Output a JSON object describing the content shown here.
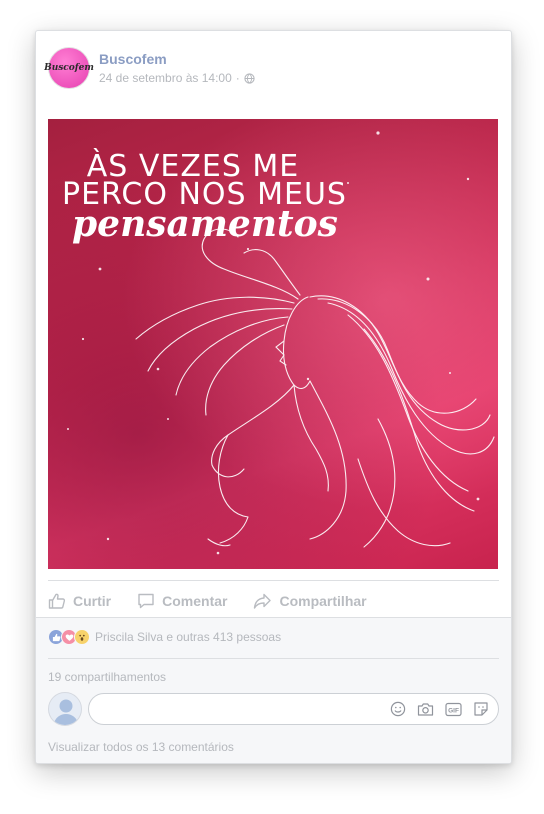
{
  "post": {
    "page_name": "Buscofem",
    "avatar_text": "Buscofem",
    "timestamp": "24 de setembro às 14:00",
    "separator": "·",
    "privacy_icon": "globe-icon"
  },
  "image": {
    "line1": "ÀS VEZES ME",
    "line2": "PERCO NOS MEUS",
    "line3": "pensamentos"
  },
  "actions": {
    "like": "Curtir",
    "comment": "Comentar",
    "share": "Compartilhar"
  },
  "reactions": {
    "icons": [
      "like-reaction-icon",
      "love-reaction-icon",
      "wow-reaction-icon"
    ],
    "text": "Priscila Silva e outras 413 pessoas"
  },
  "shares": "19 compartilhamentos",
  "comment_box": {
    "placeholder": "",
    "icons": [
      "emoji-icon",
      "camera-icon",
      "gif-icon",
      "sticker-icon"
    ],
    "gif_label": "GIF"
  },
  "view_all_comments": "Visualizar todos os 13 comentários",
  "colors": {
    "link_text": "#8b9dc3",
    "muted_text": "#b5b8bd",
    "action_text": "#b9bcc1",
    "image_pink": "#c92b52",
    "footer_bg": "#f6f7f9"
  }
}
